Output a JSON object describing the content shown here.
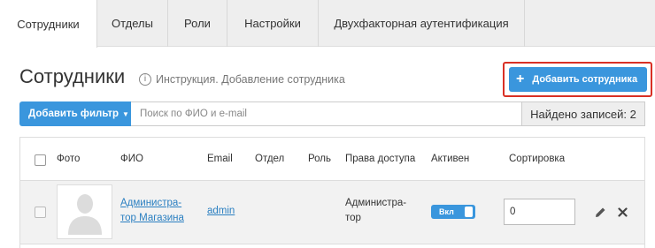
{
  "tabs": [
    {
      "label": "Сотрудники",
      "active": true
    },
    {
      "label": "Отделы",
      "active": false
    },
    {
      "label": "Роли",
      "active": false
    },
    {
      "label": "Настройки",
      "active": false
    },
    {
      "label": "Двухфакторная аутентификация",
      "active": false
    }
  ],
  "header": {
    "title": "Сотрудники",
    "help_icon": "info-icon",
    "help_link": "Инструкция. Добавление сотрудника",
    "add_button": "Добавить сотрудника",
    "add_button_icon": "plus-icon",
    "highlight_color": "#d93025"
  },
  "filter": {
    "button_label": "Добавить фильтр",
    "caret": "▼",
    "search_placeholder": "Поиск по ФИО и e-mail",
    "found_text": "Найдено записей: 2"
  },
  "table": {
    "columns": {
      "photo": "Фото",
      "name": "ФИО",
      "email": "Email",
      "department": "Отдел",
      "role": "Роль",
      "access": "Права доступа",
      "active": "Активен",
      "sort": "Сортировка"
    },
    "rows": [
      {
        "name_line1": "Администра-",
        "name_line2": "тор Магазина",
        "email": "admin",
        "department": "",
        "role": "",
        "access_line1": "Администра-",
        "access_line2": "тор",
        "active_label": "Вкл",
        "active": true,
        "sort_value": "0",
        "edit_icon": "pencil-icon",
        "delete_icon": "close-icon"
      }
    ]
  },
  "colors": {
    "accent": "#3a96dd",
    "link": "#2a7fc1",
    "tab_bar": "#eeeeee"
  }
}
